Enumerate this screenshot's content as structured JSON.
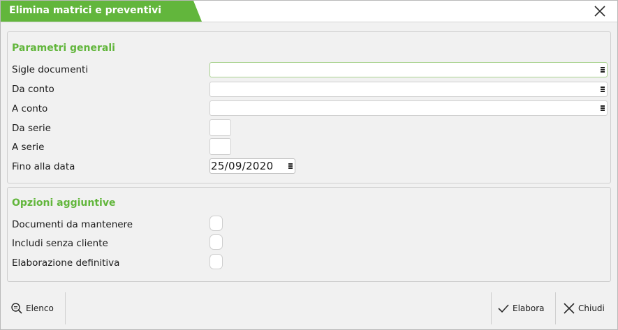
{
  "window": {
    "title": "Elimina matrici e preventivi",
    "accent_color": "#62b63c",
    "close_icon": "close-icon"
  },
  "general": {
    "title": "Parametri generali",
    "fields": [
      {
        "label": "Sigle documenti",
        "value": ""
      },
      {
        "label": "Da conto",
        "value": ""
      },
      {
        "label": "A conto",
        "value": ""
      },
      {
        "label": "Da serie",
        "value": ""
      },
      {
        "label": "A serie",
        "value": ""
      },
      {
        "label": "Fino alla data",
        "value": "25/09/2020"
      }
    ]
  },
  "options": {
    "title": "Opzioni aggiuntive",
    "items": [
      {
        "label": "Documenti da mantenere",
        "checked": false
      },
      {
        "label": "Includi senza cliente",
        "checked": false
      },
      {
        "label": "Elaborazione definitiva",
        "checked": false
      }
    ]
  },
  "footer": {
    "list_label": "Elenco",
    "list_icon": "search-list-icon",
    "process_label": "Elabora",
    "process_icon": "check-icon",
    "close_label": "Chiudi",
    "close_icon": "close-icon"
  }
}
